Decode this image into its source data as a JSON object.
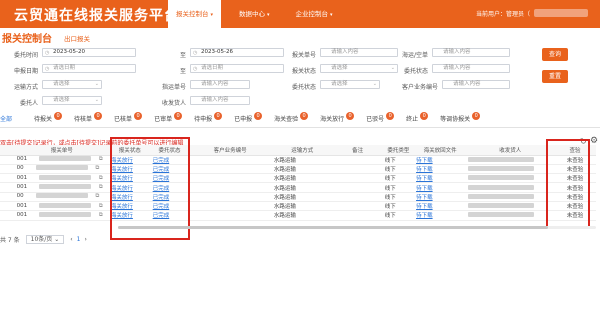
{
  "header": {
    "brand": "云贸通在线报关服务平台",
    "nav": [
      {
        "label": "报关控制台",
        "active": true
      },
      {
        "label": "数据中心",
        "active": false
      },
      {
        "label": "企业控制台",
        "active": false
      }
    ],
    "user_label": "当前用户：管理员（"
  },
  "page": {
    "title": "报关控制台",
    "subtitle": "出口报关"
  },
  "filters": {
    "labels": [
      "委托时间",
      "至",
      "报关单号",
      "海运/空单",
      "申报日期",
      "至",
      "报关状态",
      "委托状态",
      "运输方式",
      "指运单号",
      "委托状态",
      "客户业务编号",
      "委托人",
      "收发货人"
    ],
    "date_from": "2023-05-20",
    "date_to": "2023-05-26",
    "ph_declare_from": "请选日期",
    "ph_declare_to": "请选日期",
    "ph_input": "请输入内容",
    "ph_select": "请选择",
    "search_button": "查询",
    "reset_button": "重置"
  },
  "tabs": [
    {
      "label": "全部",
      "badge": "",
      "active": true
    },
    {
      "label": "待报关",
      "badge": "0"
    },
    {
      "label": "待核单",
      "badge": "0"
    },
    {
      "label": "已核单",
      "badge": "0"
    },
    {
      "label": "已审单",
      "badge": "0"
    },
    {
      "label": "待申报",
      "badge": "0"
    },
    {
      "label": "已申报",
      "badge": "0"
    },
    {
      "label": "海关查验",
      "badge": "0"
    },
    {
      "label": "海关放行",
      "badge": "0"
    },
    {
      "label": "已驳号",
      "badge": "0"
    },
    {
      "label": "终止",
      "badge": "0"
    },
    {
      "label": "等调协报关",
      "badge": "0"
    }
  ],
  "notice": "双击[待提交]记录行，或点击[待提交]记录前的委托单号可以进行编辑",
  "table": {
    "headers": [
      "报关单号",
      "报关状态",
      "委托状态",
      "客户业务编号",
      "运输方式",
      "备注",
      "委托类型",
      "海关放回文件",
      "收发货人",
      "查验"
    ],
    "rows": [
      {
        "id": "001",
        "customs": "海关放行",
        "status": "已完成",
        "transport": "水路运输",
        "type": "线下",
        "file": "待下载",
        "inspect": "未查验"
      },
      {
        "id": "00",
        "customs": "海关放行",
        "status": "已完成",
        "transport": "水路运输",
        "type": "线下",
        "file": "待下载",
        "inspect": "未查验"
      },
      {
        "id": "001",
        "customs": "海关放行",
        "status": "已完成",
        "transport": "水路运输",
        "type": "线下",
        "file": "待下载",
        "inspect": "未查验"
      },
      {
        "id": "001",
        "customs": "海关放行",
        "status": "已完成",
        "transport": "水路运输",
        "type": "线下",
        "file": "待下载",
        "inspect": "未查验"
      },
      {
        "id": "00",
        "customs": "海关放行",
        "status": "已完成",
        "transport": "水路运输",
        "type": "线下",
        "file": "待下载",
        "inspect": "未查验"
      },
      {
        "id": "001",
        "customs": "海关放行",
        "status": "已完成",
        "transport": "水路运输",
        "type": "线下",
        "file": "待下载",
        "inspect": "未查验"
      },
      {
        "id": "001",
        "customs": "海关放行",
        "status": "已完成",
        "transport": "水路运输",
        "type": "线下",
        "file": "待下载",
        "inspect": "未查验"
      }
    ]
  },
  "pager": {
    "total": "共 7 条",
    "page_size": "10条/页",
    "current": "1"
  },
  "colors": {
    "brand": "#e9621c",
    "link": "#2a74d8",
    "alert": "#d9251d"
  }
}
